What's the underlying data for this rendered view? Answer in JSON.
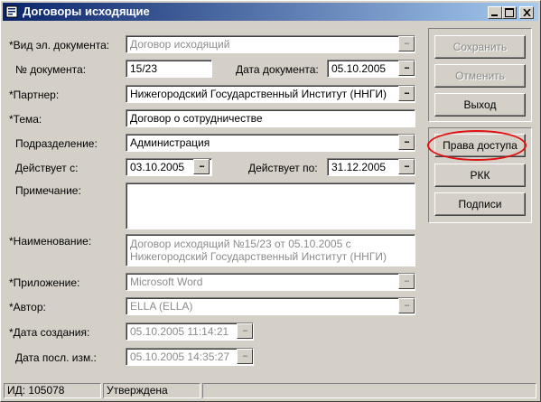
{
  "window": {
    "title": "Договоры исходящие"
  },
  "fields": {
    "doc_type": {
      "label": "*Вид эл. документа:",
      "value": "Договор исходящий"
    },
    "doc_no": {
      "label": "№ документа:",
      "value": "15/23"
    },
    "doc_date": {
      "label": "Дата документа:",
      "value": "05.10.2005"
    },
    "partner": {
      "label": "*Партнер:",
      "value": "Нижегородский Государственный Институт (ННГИ)"
    },
    "subject": {
      "label": "*Тема:",
      "value": "Договор о сотрудничестве"
    },
    "department": {
      "label": "Подразделение:",
      "value": "Администрация"
    },
    "valid_from": {
      "label": "Действует с:",
      "value": "03.10.2005"
    },
    "valid_to": {
      "label": "Действует по:",
      "value": "31.12.2005"
    },
    "note": {
      "label": "Примечание:",
      "value": ""
    },
    "name": {
      "label": "*Наименование:",
      "value": "Договор исходящий №15/23 от 05.10.2005 с Нижегородский Государственный Институт (ННГИ)"
    },
    "attachment": {
      "label": "*Приложение:",
      "value": "Microsoft Word"
    },
    "author": {
      "label": "*Автор:",
      "value": "ELLA (ELLA)"
    },
    "created": {
      "label": "*Дата создания:",
      "value": "05.10.2005 11:14:21"
    },
    "modified": {
      "label": "Дата посл. изм.:",
      "value": "05.10.2005 14:35:27"
    }
  },
  "buttons": {
    "save": "Сохранить",
    "cancel": "Отменить",
    "exit": "Выход",
    "access": "Права доступа",
    "rkk": "РКК",
    "signatures": "Подписи",
    "ellipsis": "..."
  },
  "status": {
    "id": "ИД: 105078",
    "state": "Утверждена"
  },
  "colors": {
    "title_start": "#0a246a",
    "title_end": "#a6caf0",
    "highlight": "#e01010"
  }
}
